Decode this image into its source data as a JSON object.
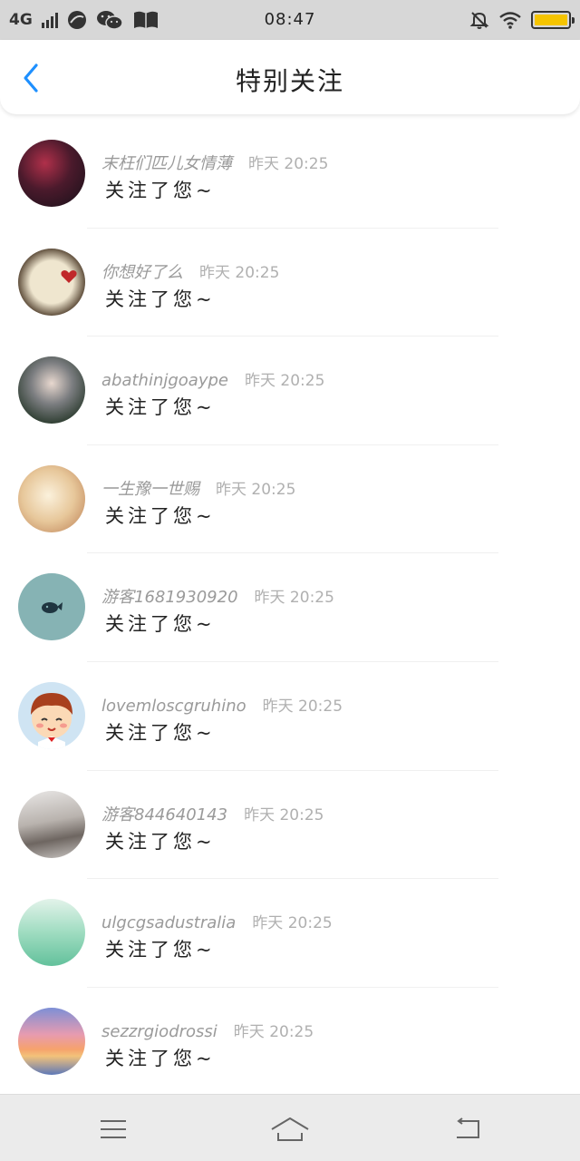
{
  "status_bar": {
    "network": "4G",
    "time": "08:47"
  },
  "header": {
    "title": "特别关注"
  },
  "list": [
    {
      "username": "末枉们匹儿女情薄",
      "time": "昨天 20:25",
      "action": "关注了您~",
      "avatar_color": "#3a1a26"
    },
    {
      "username": "你想好了么",
      "time": "昨天 20:25",
      "action": "关注了您~",
      "avatar_color": "#6b5536"
    },
    {
      "username": "abathinjgoaype",
      "time": "昨天 20:25",
      "action": "关注了您~",
      "avatar_color": "#2d3b30"
    },
    {
      "username": "一生豫一世赐",
      "time": "昨天 20:25",
      "action": "关注了您~",
      "avatar_color": "#d9b48a"
    },
    {
      "username": "游客1681930920",
      "time": "昨天 20:25",
      "action": "关注了您~",
      "avatar_color": "#86b3b4"
    },
    {
      "username": "lovemloscgruhino",
      "time": "昨天 20:25",
      "action": "关注了您~",
      "avatar_color": "#cfe4f3"
    },
    {
      "username": "游客844640143",
      "time": "昨天 20:25",
      "action": "关注了您~",
      "avatar_color": "#8f8c8a"
    },
    {
      "username": "ulgcgsadustralia",
      "time": "昨天 20:25",
      "action": "关注了您~",
      "avatar_color": "#8fd6b6"
    },
    {
      "username": "sezzrgiodrossi",
      "time": "昨天 20:25",
      "action": "关注了您~",
      "avatar_color": "#f0a074"
    }
  ],
  "colors": {
    "accent": "#1e90ff",
    "status_bar_bg": "#d7d7d7",
    "battery": "#f5c400",
    "nav_bg": "#ebebeb"
  },
  "icons": {
    "back": "chevron-left-icon",
    "menu": "menu-icon",
    "home": "home-icon",
    "return": "return-icon"
  }
}
